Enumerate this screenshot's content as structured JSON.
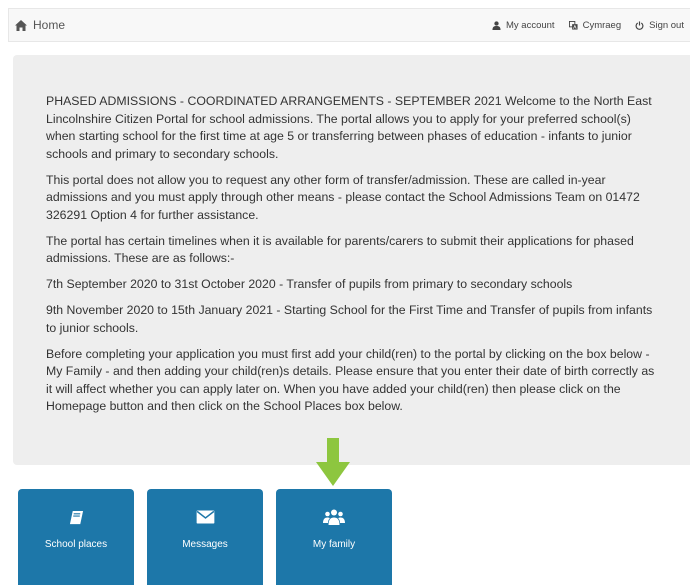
{
  "nav": {
    "home_label": "Home",
    "account_label": "My account",
    "language_label": "Cymraeg",
    "signout_label": "Sign out"
  },
  "intro": {
    "paragraphs": [
      "PHASED ADMISSIONS - COORDINATED ARRANGEMENTS - SEPTEMBER 2021 Welcome to the North East Lincolnshire Citizen Portal for school admissions. The portal allows you to apply for your preferred school(s) when starting school for the first time at age 5 or transferring between phases of education - infants to junior schools and primary to secondary schools.",
      "This portal does not allow you to request any other form of transfer/admission. These are called in-year admissions and you must apply through other means - please contact the School Admissions Team on 01472 326291 Option 4 for further assistance.",
      "The portal has certain timelines when it is available for parents/carers to submit their applications for phased admissions. These are as follows:-",
      "7th September 2020 to 31st October 2020 - Transfer of pupils from primary to secondary schools",
      "9th November 2020 to 15th January 2021 - Starting School for the First Time and Transfer of pupils from infants to junior schools.",
      "Before completing your application you must first add your child(ren) to the portal by clicking on the box below - My Family - and then adding your child(ren)s details. Please ensure that you enter their date of birth correctly as it will affect whether you can apply later on. When you have added your child(ren) then please click on the Homepage button and then click on the School Places box below."
    ]
  },
  "tiles": [
    {
      "label": "School places",
      "icon": "book-icon"
    },
    {
      "label": "Messages",
      "icon": "envelope-icon"
    },
    {
      "label": "My family",
      "icon": "users-icon"
    }
  ],
  "colors": {
    "tile_background": "#1d77a9",
    "panel_background": "#eeeeee",
    "arrow": "#8dc63f"
  }
}
